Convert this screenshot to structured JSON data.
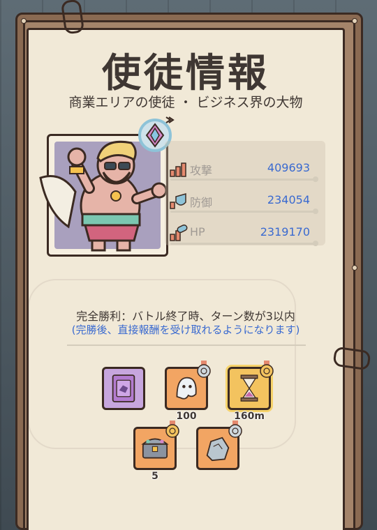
{
  "header": {
    "title": "使徒情報",
    "subtitle": "商業エリアの使徒 ・ ビジネス界の大物"
  },
  "stats": [
    {
      "label": "攻撃",
      "value": "409693",
      "icon": "attack-icon"
    },
    {
      "label": "防御",
      "value": "234054",
      "icon": "defense-icon"
    },
    {
      "label": "HP",
      "value": "2319170",
      "icon": "hp-icon"
    }
  ],
  "condition": {
    "text": "完全勝利：バトル終了時、ターン数が3以内",
    "note": "(完勝後、直接報酬を受け取れるようになります)"
  },
  "rewards": [
    {
      "name": "card-reward",
      "qty": ""
    },
    {
      "name": "ghost-reward",
      "qty": "100"
    },
    {
      "name": "hourglass-reward",
      "qty": "160m"
    },
    {
      "name": "treasure-chest-reward",
      "qty": "5"
    },
    {
      "name": "stone-reward",
      "qty": ""
    }
  ],
  "colors": {
    "accent_blue": "#3a6ad0",
    "paper": "#f1e9d7",
    "frame": "#8a6a52"
  }
}
